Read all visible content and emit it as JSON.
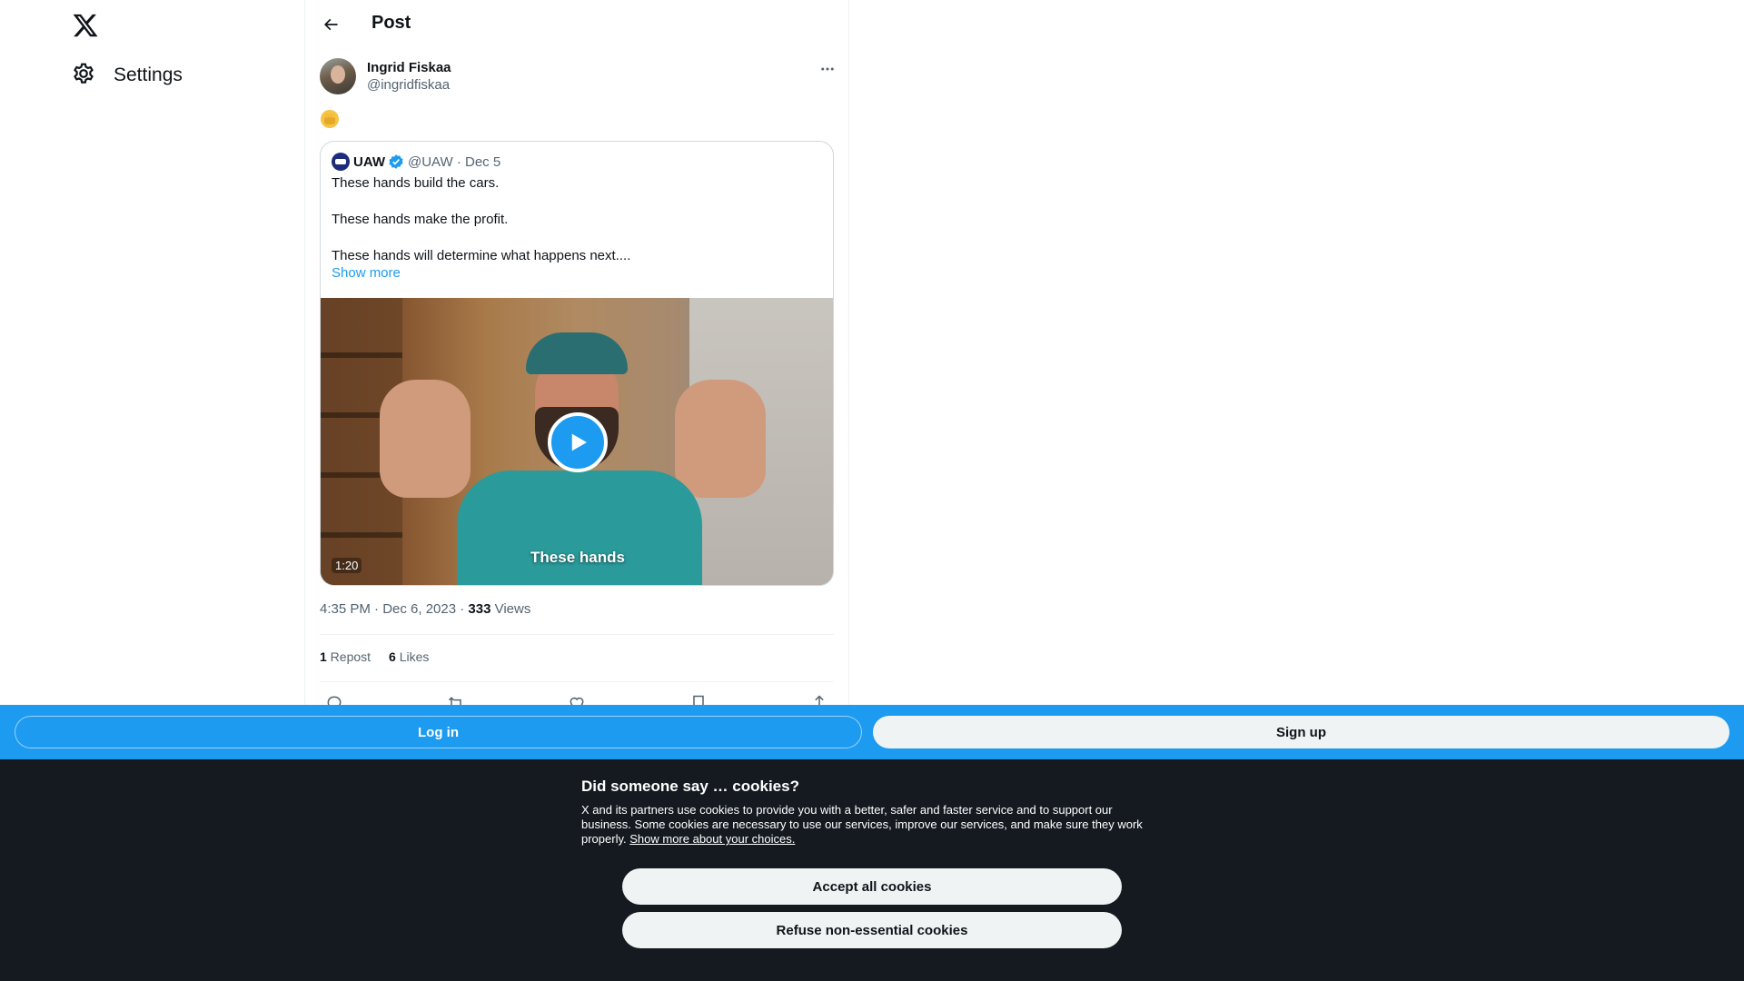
{
  "nav": {
    "logo_icon": "x-logo-icon",
    "settings_label": "Settings"
  },
  "header": {
    "title": "Post"
  },
  "post": {
    "author_name": "Ingrid Fiskaa",
    "author_handle": "@ingridfiskaa",
    "body_emoji": "✊",
    "timestamp": "4:35 PM · Dec 6, 2023 · ",
    "views_count": "333",
    "views_label": " Views",
    "repost_count": "1",
    "repost_label": " Repost",
    "likes_count": "6",
    "likes_label": " Likes"
  },
  "quote": {
    "name": "UAW",
    "handle_date": "@UAW · Dec 5",
    "lines": [
      "These hands build the cars.",
      "These hands make the profit.",
      "These hands will determine what happens next...."
    ],
    "show_more": "Show more",
    "video_caption": "These hands",
    "video_duration": "1:20"
  },
  "bottom_bar": {
    "login": "Log in",
    "signup": "Sign up"
  },
  "cookie": {
    "title": "Did someone say … cookies?",
    "text": "X and its partners use cookies to provide you with a better, safer and faster service and to support our business. Some cookies are necessary to use our services, improve our services, and make sure they work properly. ",
    "link": "Show more about your choices.",
    "accept": "Accept all cookies",
    "refuse": "Refuse non-essential cookies"
  },
  "colors": {
    "accent": "#1d9bf0",
    "banner_bg": "#141a20",
    "text_secondary": "#536471"
  }
}
